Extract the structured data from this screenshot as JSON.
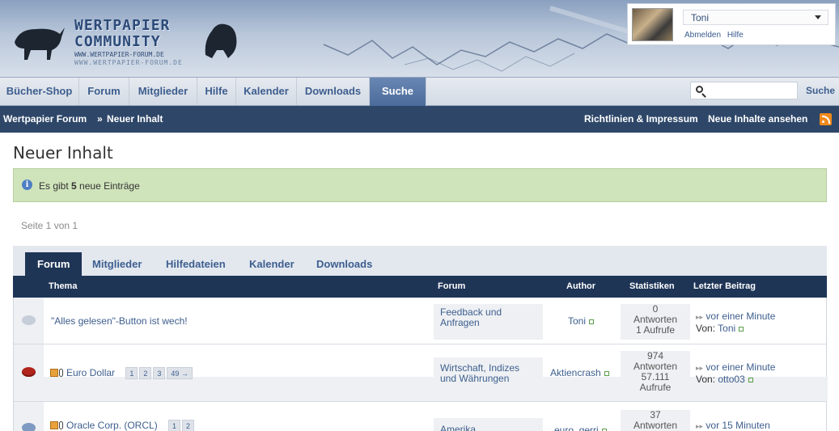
{
  "header": {
    "logo": {
      "line1": "WERTPAPIER",
      "line2": "COMMUNITY",
      "line3": "WWW.WERTPAPIER-FORUM.DE",
      "line4": "WWW.WERTPAPIER-FORUM.DE"
    },
    "user": {
      "name": "Toni",
      "logout": "Abmelden",
      "help": "Hilfe"
    }
  },
  "nav": {
    "items": [
      {
        "label": "Bücher-Shop"
      },
      {
        "label": "Forum"
      },
      {
        "label": "Mitglieder"
      },
      {
        "label": "Hilfe"
      },
      {
        "label": "Kalender"
      },
      {
        "label": "Downloads"
      },
      {
        "label": "Suche",
        "active": true
      }
    ],
    "search_placeholder": "",
    "search_button": "Suche"
  },
  "breadcrumb": {
    "root": "Wertpapier Forum",
    "separator": "»",
    "current": "Neuer Inhalt",
    "link_policy": "Richtlinien & Impressum",
    "link_new": "Neue Inhalte ansehen"
  },
  "main": {
    "title": "Neuer Inhalt",
    "notice_pre": "Es gibt ",
    "notice_count": "5",
    "notice_post": " neue Einträge",
    "page_info": "Seite 1 von 1",
    "tabs": [
      {
        "label": "Forum",
        "active": true
      },
      {
        "label": "Mitglieder"
      },
      {
        "label": "Hilfedateien"
      },
      {
        "label": "Kalender"
      },
      {
        "label": "Downloads"
      }
    ],
    "columns": {
      "topic": "Thema",
      "forum": "Forum",
      "author": "Author",
      "stats": "Statistiken",
      "last": "Letzter Beitrag"
    },
    "rows": [
      {
        "title": "\"Alles gelesen\"-Button ist wech!",
        "forum_l1": "Feedback und",
        "forum_l2": "Anfragen",
        "author": "Toni",
        "stat_num": "0",
        "stat_label": "Antworten",
        "stat_views": "1 Aufrufe",
        "stat_views_l2": "",
        "last_when": "vor einer Minute",
        "last_by_label": "Von:",
        "last_by": "Toni"
      },
      {
        "title": "Euro Dollar",
        "pages": [
          "1",
          "2",
          "3",
          "49 →"
        ],
        "forum_l1": "Wirtschaft, Indizes",
        "forum_l2": "und Währungen",
        "author": "Aktiencrash",
        "stat_num": "974",
        "stat_label": "Antworten",
        "stat_views": "57.111",
        "stat_views_l2": "Aufrufe",
        "last_when": "vor einer Minute",
        "last_by_label": "Von:",
        "last_by": "otto03"
      },
      {
        "title": "Oracle Corp. (ORCL)",
        "pages": [
          "1",
          "2"
        ],
        "forum_l1": "Amerika",
        "forum_l2": "",
        "author": "euro_gerri",
        "stat_num": "37",
        "stat_label": "Antworten",
        "stat_views": "",
        "stat_views_l2": "",
        "last_when": "vor 15 Minuten",
        "last_by_label": "",
        "last_by": ""
      }
    ]
  },
  "colors": {
    "nav_active": "#4b6b9b",
    "crumb_bar": "#2e4769",
    "table_head": "#1e3556",
    "notice_bg": "#d0e4bb",
    "link": "#3d5e8e"
  }
}
